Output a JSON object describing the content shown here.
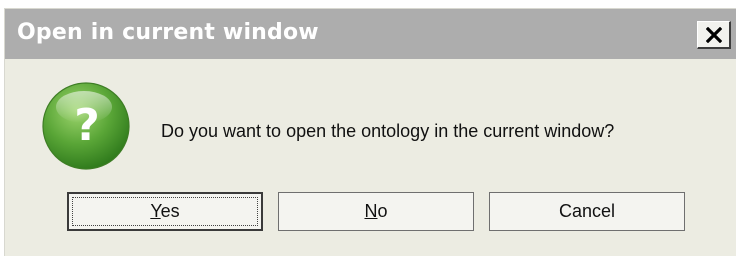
{
  "dialog": {
    "title": "Open in current window",
    "close_label": "close",
    "icon": "question-icon",
    "message": "Do you want to open the ontology in the current window?",
    "buttons": {
      "yes": {
        "mnemonic": "Y",
        "rest": "es"
      },
      "no": {
        "mnemonic": "N",
        "rest": "o"
      },
      "cancel": {
        "label": "Cancel"
      }
    }
  },
  "colors": {
    "titlebar": "#adadad",
    "dialog_bg": "#ecece2",
    "icon_green": "#5aa637",
    "button_bg": "#f4f4f0"
  }
}
